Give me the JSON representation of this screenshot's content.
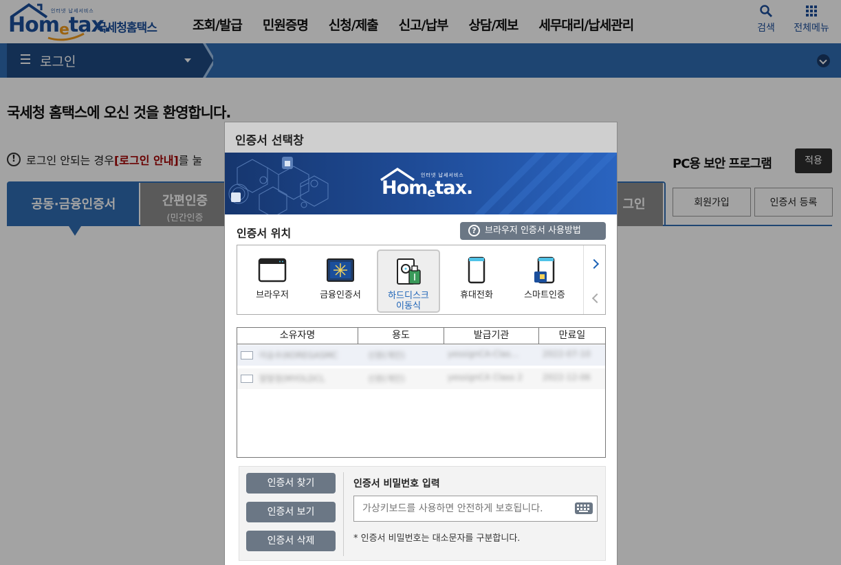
{
  "header": {
    "logo_word_main": "Hom",
    "logo_word_e": "e",
    "logo_word_end": "tax.",
    "logo_tagline": "인터넷 납세서비스",
    "logo_ko": "국세청홈택스",
    "gnb": [
      "조회/발급",
      "민원증명",
      "신청/제출",
      "신고/납부",
      "상담/제보",
      "세무대리/납세관리"
    ],
    "search_label": "검색",
    "menu_label": "전체메뉴",
    "icon_search": "search-icon",
    "icon_menu": "grid-menu-icon"
  },
  "navbar": {
    "title": "로그인"
  },
  "page": {
    "welcome": "국세청 홈택스에 오신 것을 환영합니다.",
    "notice_prefix": "로그인 안되는 경우 ",
    "notice_link": "[로그인 안내]",
    "notice_suffix": "를 눌",
    "pc_security": "PC용 보안 프로그램",
    "apply": "적용",
    "tab_cert": "공동·금융인증서",
    "tab_simple_1": "간편인증",
    "tab_simple_2": "(민간인증",
    "tab_other": "그인",
    "join": "회원가입",
    "cert_register": "인증서 등록"
  },
  "modal": {
    "title": "인증서 선택창",
    "banner_tagline": "인터넷 납세서비스",
    "location_label": "인증서 위치",
    "help_button": "브라우저 인증서 사용방법",
    "locations": [
      {
        "label": "브라우저",
        "icon": "browser-icon"
      },
      {
        "label": "금융인증서",
        "icon": "finance-cert-icon"
      },
      {
        "label": "하드디스크\n이동식",
        "icon": "harddisk-removable-icon",
        "selected": true
      },
      {
        "label": "휴대전화",
        "icon": "mobile-phone-icon"
      },
      {
        "label": "스마트인증",
        "icon": "smart-cert-icon"
      }
    ],
    "table_headers": [
      "소유자명",
      "용도",
      "발급기관",
      "만료일"
    ],
    "certificates": [
      {
        "owner": "이승수(KOREGASMC",
        "usage": "신원(개인)",
        "issuer": "yessignCA-Clas…",
        "expiry": "2022-07-10"
      },
      {
        "owner": "말말정(MYOLDCL",
        "usage": "신원(개인)",
        "issuer": "yessignCA Class 2",
        "expiry": "2022-12-06"
      }
    ],
    "btn_find": "인증서 찾기",
    "btn_view": "인증서 보기",
    "btn_delete": "인증서 삭제",
    "pw_label": "인증서 비밀번호 입력",
    "pw_placeholder": "가상키보드를 사용하면 안전하게 보호됩니다.",
    "pw_note": "* 인증서 비밀번호는 대소문자를 구분합니다.",
    "icon_keyboard": "virtual-keyboard-icon"
  },
  "colors": {
    "brand_blue": "#2f6db3",
    "logo_blue": "#1b4f9c",
    "logo_orange": "#f29b1b",
    "notice_red": "#a40000",
    "button_gray": "#6b7785"
  }
}
